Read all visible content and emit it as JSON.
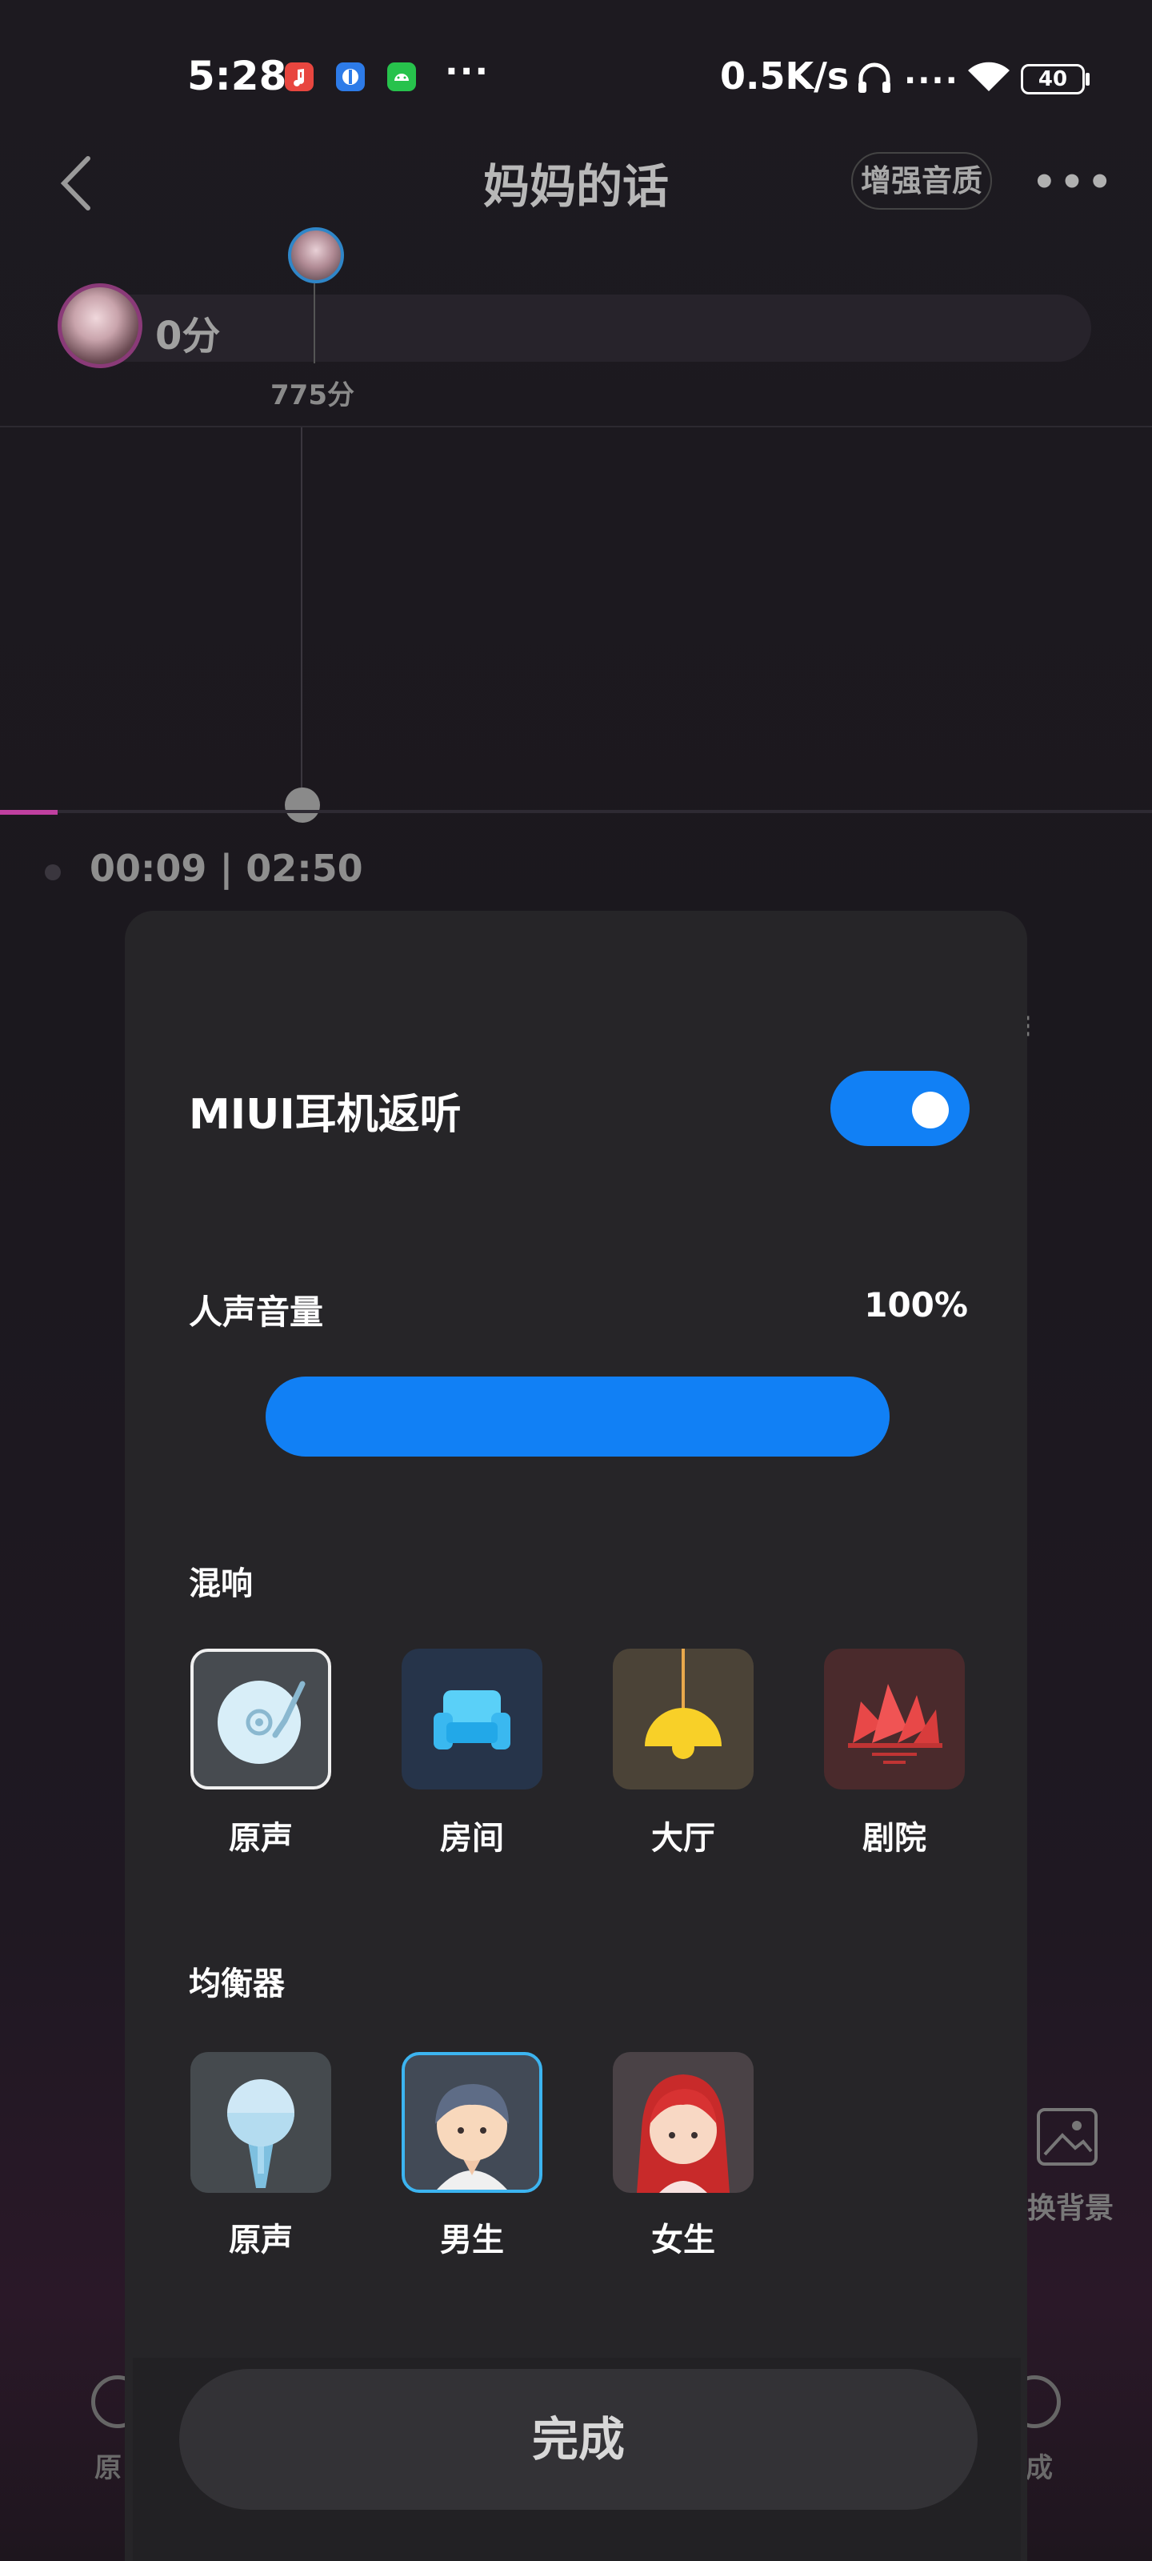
{
  "status_bar": {
    "time": "5:28",
    "network_speed": "0.5K/s",
    "battery": "40",
    "more_dots": "···",
    "signal_dots": "....",
    "app_icons": [
      {
        "name": "music-app-icon",
        "color": "#e8463f"
      },
      {
        "name": "security-app-icon",
        "color": "#2d7be8"
      },
      {
        "name": "android-app-icon",
        "color": "#27c24c"
      }
    ]
  },
  "header": {
    "title": "妈妈的话",
    "enhance_label": "增强音质"
  },
  "score": {
    "current": "0分",
    "marker": "775分"
  },
  "playback": {
    "time": "00:09 | 02:50",
    "progress": 0.05
  },
  "background_controls": {
    "change_bg_label": "换背景",
    "bottom_left_label": "原",
    "bottom_right_label": "成"
  },
  "dialog": {
    "headset_label": "MIUI耳机返听",
    "headset_enabled": true,
    "volume_label": "人声音量",
    "volume_value": "100%",
    "volume_fraction": 1.0,
    "reverb_label": "混响",
    "reverb_options": [
      {
        "label": "原声",
        "icon": "record-disc-icon",
        "selected": true
      },
      {
        "label": "房间",
        "icon": "sofa-icon",
        "selected": false
      },
      {
        "label": "大厅",
        "icon": "pendant-lamp-icon",
        "selected": false
      },
      {
        "label": "剧院",
        "icon": "opera-house-icon",
        "selected": false
      }
    ],
    "eq_label": "均衡器",
    "eq_options": [
      {
        "label": "原声",
        "icon": "microphone-icon",
        "selected": false
      },
      {
        "label": "男生",
        "icon": "male-avatar-icon",
        "selected": true
      },
      {
        "label": "女生",
        "icon": "female-avatar-icon",
        "selected": false
      }
    ],
    "done_label": "完成"
  },
  "colors": {
    "accent": "#1180f5",
    "dialog_bg": "#262528",
    "progress": "#c040a0"
  }
}
